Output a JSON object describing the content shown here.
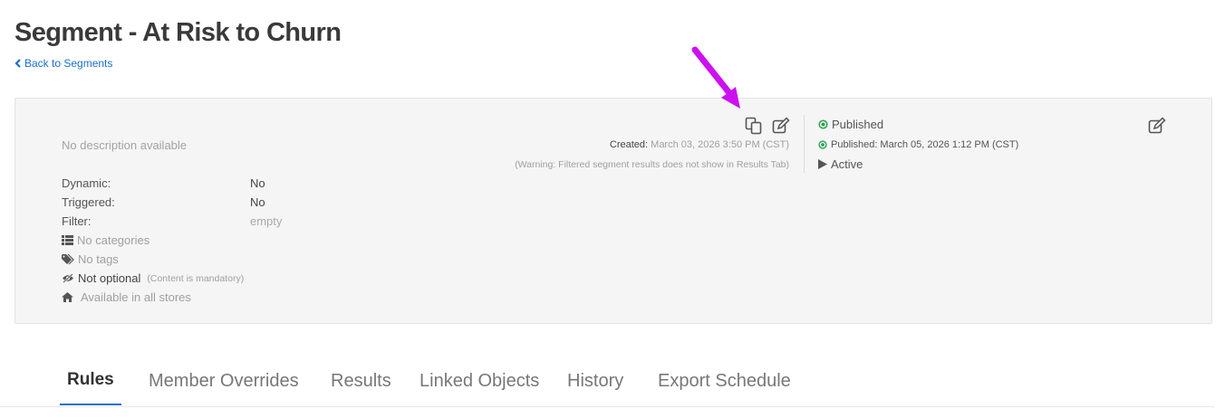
{
  "page": {
    "title": "Segment - At Risk to Churn",
    "back_link": "Back to Segments"
  },
  "details": {
    "description": "No description available",
    "attributes": [
      {
        "label": "Dynamic:",
        "value": "No"
      },
      {
        "label": "Triggered:",
        "value": "No"
      },
      {
        "label": "Filter:",
        "value": "empty"
      }
    ],
    "categories": "No categories",
    "tags": "No tags",
    "optional": "Not optional",
    "optional_note": "(Content is mandatory)",
    "stores": "Available in all stores",
    "created_label": "Created:",
    "created_value": "March 03, 2026 3:50 PM (CST)",
    "warning": "(Warning: Filtered segment results does not show in Results Tab)"
  },
  "status": {
    "label": "Published",
    "published_date": "Published: March 05, 2026 1:12 PM (CST)",
    "active_label": "Active"
  },
  "icons": {
    "copy": "copy-icon",
    "edit": "edit-icon",
    "annotation": "magenta-arrow",
    "arrow_color": "#cc11ee",
    "link_color": "#1a6fd0",
    "published_color": "#2aa04a"
  },
  "tabs": [
    {
      "label": "Rules",
      "active": true
    },
    {
      "label": "Member Overrides"
    },
    {
      "label": "Results"
    },
    {
      "label": "Linked Objects"
    },
    {
      "label": "History"
    },
    {
      "label": "Export Schedule"
    }
  ]
}
